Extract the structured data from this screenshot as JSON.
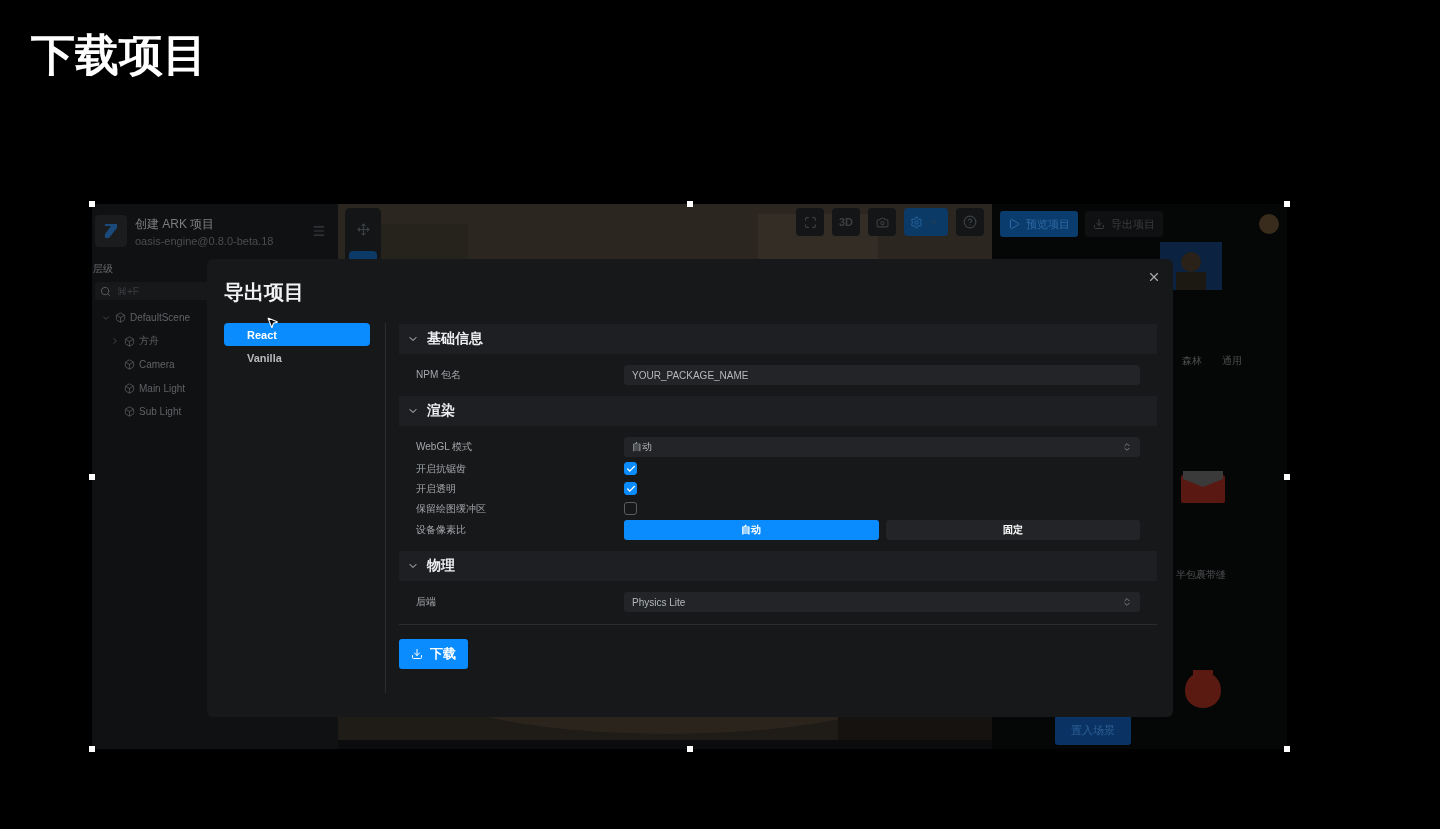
{
  "slide_title": "下载项目",
  "app": {
    "project": {
      "title": "创建 ARK 项目",
      "version": "oasis-engine@0.8.0-beta.18"
    },
    "hierarchy": {
      "title": "层级",
      "search_placeholder": "⌘+F",
      "tree": [
        {
          "label": "DefaultScene",
          "expanded": true,
          "children": [
            {
              "label": "方舟",
              "expanded": false
            },
            {
              "label": "Camera"
            },
            {
              "label": "Main Light"
            },
            {
              "label": "Sub Light"
            }
          ]
        }
      ]
    },
    "viewport_toolbar": {
      "mode_label": "3D"
    },
    "header_buttons": [
      {
        "kind": "play",
        "label": "预览项目"
      },
      {
        "kind": "download",
        "label": "导出项目"
      }
    ],
    "asset_tabs": [
      "森林",
      "通用"
    ],
    "asset_label": "半包裹带缝",
    "place_button": "置入场景"
  },
  "dialog": {
    "title": "导出项目",
    "templates": [
      {
        "label": "React",
        "selected": true
      },
      {
        "label": "Vanilla",
        "selected": false
      }
    ],
    "sections": [
      {
        "title": "基础信息",
        "expanded": true,
        "fields": [
          {
            "kind": "text",
            "label": "NPM 包名",
            "value": "YOUR_PACKAGE_NAME"
          }
        ]
      },
      {
        "title": "渲染",
        "expanded": true,
        "fields": [
          {
            "kind": "select",
            "label": "WebGL 模式",
            "value": "自动"
          },
          {
            "kind": "checkbox",
            "label": "开启抗锯齿",
            "checked": true
          },
          {
            "kind": "checkbox",
            "label": "开启透明",
            "checked": true
          },
          {
            "kind": "checkbox",
            "label": "保留绘图缓冲区",
            "checked": false
          },
          {
            "kind": "segmented",
            "label": "设备像素比",
            "options": [
              {
                "label": "自动",
                "selected": true
              },
              {
                "label": "固定",
                "selected": false
              }
            ]
          }
        ]
      },
      {
        "title": "物理",
        "expanded": true,
        "fields": [
          {
            "kind": "select",
            "label": "后端",
            "value": "Physics Lite"
          }
        ]
      }
    ],
    "download_button": "下载"
  }
}
